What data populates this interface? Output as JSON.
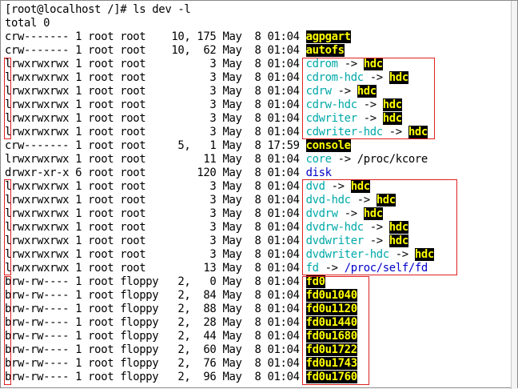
{
  "terminal": {
    "lines": [
      [
        {
          "t": "[root@localhost /]# ls dev -l",
          "c": "n"
        }
      ],
      [
        {
          "t": "total 0",
          "c": "n"
        }
      ],
      [
        {
          "t": "crw------- 1 root root    10, 175 May  8 01:04 ",
          "c": "n"
        },
        {
          "t": "agpgart",
          "c": "hl"
        }
      ],
      [
        {
          "t": "crw------- 1 root root    10,  62 May  8 01:04 ",
          "c": "n"
        },
        {
          "t": "autofs",
          "c": "hl"
        }
      ],
      [
        {
          "t": "lrwxrwxrwx 1 root root          3 May  8 01:04 ",
          "c": "n"
        },
        {
          "t": "cdrom",
          "c": "cyan"
        },
        {
          "t": " -> ",
          "c": "n"
        },
        {
          "t": "hdc",
          "c": "hl"
        }
      ],
      [
        {
          "t": "lrwxrwxrwx 1 root root          3 May  8 01:04 ",
          "c": "n"
        },
        {
          "t": "cdrom-hdc",
          "c": "cyan"
        },
        {
          "t": " -> ",
          "c": "n"
        },
        {
          "t": "hdc",
          "c": "hl"
        }
      ],
      [
        {
          "t": "lrwxrwxrwx 1 root root          3 May  8 01:04 ",
          "c": "n"
        },
        {
          "t": "cdrw",
          "c": "cyan"
        },
        {
          "t": " -> ",
          "c": "n"
        },
        {
          "t": "hdc",
          "c": "hl"
        }
      ],
      [
        {
          "t": "lrwxrwxrwx 1 root root          3 May  8 01:04 ",
          "c": "n"
        },
        {
          "t": "cdrw-hdc",
          "c": "cyan"
        },
        {
          "t": " -> ",
          "c": "n"
        },
        {
          "t": "hdc",
          "c": "hl"
        }
      ],
      [
        {
          "t": "lrwxrwxrwx 1 root root          3 May  8 01:04 ",
          "c": "n"
        },
        {
          "t": "cdwriter",
          "c": "cyan"
        },
        {
          "t": " -> ",
          "c": "n"
        },
        {
          "t": "hdc",
          "c": "hl"
        }
      ],
      [
        {
          "t": "lrwxrwxrwx 1 root root          3 May  8 01:04 ",
          "c": "n"
        },
        {
          "t": "cdwriter-hdc",
          "c": "cyan"
        },
        {
          "t": " -> ",
          "c": "n"
        },
        {
          "t": "hdc",
          "c": "hl"
        }
      ],
      [
        {
          "t": "crw------- 1 root root     5,   1 May  8 17:59 ",
          "c": "n"
        },
        {
          "t": "console",
          "c": "hl"
        }
      ],
      [
        {
          "t": "lrwxrwxrwx 1 root root         11 May  8 01:04 ",
          "c": "n"
        },
        {
          "t": "core",
          "c": "cyan"
        },
        {
          "t": " -> /proc/kcore",
          "c": "n"
        }
      ],
      [
        {
          "t": "drwxr-xr-x 6 root root        120 May  8 01:04 ",
          "c": "n"
        },
        {
          "t": "disk",
          "c": "blue"
        }
      ],
      [
        {
          "t": "lrwxrwxrwx 1 root root          3 May  8 01:04 ",
          "c": "n"
        },
        {
          "t": "dvd",
          "c": "cyan"
        },
        {
          "t": " -> ",
          "c": "n"
        },
        {
          "t": "hdc",
          "c": "hl"
        }
      ],
      [
        {
          "t": "lrwxrwxrwx 1 root root          3 May  8 01:04 ",
          "c": "n"
        },
        {
          "t": "dvd-hdc",
          "c": "cyan"
        },
        {
          "t": " -> ",
          "c": "n"
        },
        {
          "t": "hdc",
          "c": "hl"
        }
      ],
      [
        {
          "t": "lrwxrwxrwx 1 root root          3 May  8 01:04 ",
          "c": "n"
        },
        {
          "t": "dvdrw",
          "c": "cyan"
        },
        {
          "t": " -> ",
          "c": "n"
        },
        {
          "t": "hdc",
          "c": "hl"
        }
      ],
      [
        {
          "t": "lrwxrwxrwx 1 root root          3 May  8 01:04 ",
          "c": "n"
        },
        {
          "t": "dvdrw-hdc",
          "c": "cyan"
        },
        {
          "t": " -> ",
          "c": "n"
        },
        {
          "t": "hdc",
          "c": "hl"
        }
      ],
      [
        {
          "t": "lrwxrwxrwx 1 root root          3 May  8 01:04 ",
          "c": "n"
        },
        {
          "t": "dvdwriter",
          "c": "cyan"
        },
        {
          "t": " -> ",
          "c": "n"
        },
        {
          "t": "hdc",
          "c": "hl"
        }
      ],
      [
        {
          "t": "lrwxrwxrwx 1 root root          3 May  8 01:04 ",
          "c": "n"
        },
        {
          "t": "dvdwriter-hdc",
          "c": "cyan"
        },
        {
          "t": " -> ",
          "c": "n"
        },
        {
          "t": "hdc",
          "c": "hl"
        }
      ],
      [
        {
          "t": "lrwxrwxrwx 1 root root         13 May  8 01:04 ",
          "c": "n"
        },
        {
          "t": "fd",
          "c": "cyan"
        },
        {
          "t": " -> ",
          "c": "n"
        },
        {
          "t": "/proc/self/fd",
          "c": "blue"
        }
      ],
      [
        {
          "t": "brw-rw---- 1 root floppy   2,   0 May  8 01:04 ",
          "c": "n"
        },
        {
          "t": "fd0",
          "c": "hl"
        }
      ],
      [
        {
          "t": "brw-rw---- 1 root floppy   2,  84 May  8 01:04 ",
          "c": "n"
        },
        {
          "t": "fd0u1040",
          "c": "hl"
        }
      ],
      [
        {
          "t": "brw-rw---- 1 root floppy   2,  88 May  8 01:04 ",
          "c": "n"
        },
        {
          "t": "fd0u1120",
          "c": "hl"
        }
      ],
      [
        {
          "t": "brw-rw---- 1 root floppy   2,  28 May  8 01:04 ",
          "c": "n"
        },
        {
          "t": "fd0u1440",
          "c": "hl"
        }
      ],
      [
        {
          "t": "brw-rw---- 1 root floppy   2,  44 May  8 01:04 ",
          "c": "n"
        },
        {
          "t": "fd0u1680",
          "c": "hl"
        }
      ],
      [
        {
          "t": "brw-rw---- 1 root floppy   2,  60 May  8 01:04 ",
          "c": "n"
        },
        {
          "t": "fd0u1722",
          "c": "hl"
        }
      ],
      [
        {
          "t": "brw-rw---- 1 root floppy   2,  76 May  8 01:04 ",
          "c": "n"
        },
        {
          "t": "fd0u1743",
          "c": "hl"
        }
      ],
      [
        {
          "t": "brw-rw---- 1 root floppy   2,  96 May  8 01:04 ",
          "c": "n"
        },
        {
          "t": "fd0u1760",
          "c": "hl"
        }
      ]
    ]
  },
  "colors": {
    "background": "#ffffff",
    "text": "#000000",
    "symlink": "#00a8a8",
    "directory": "#0000c8",
    "highlight_bg": "#000000",
    "highlight_fg": "#ffff00",
    "annotation_box": "#e02020"
  }
}
